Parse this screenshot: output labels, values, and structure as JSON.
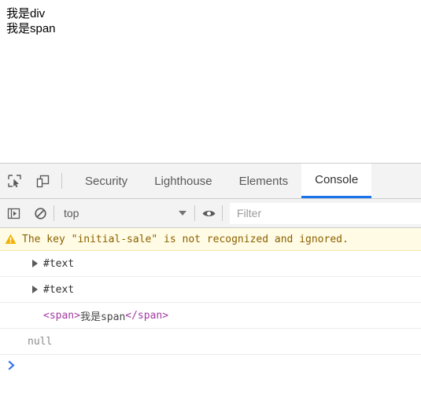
{
  "page": {
    "lines": [
      "我是div",
      "我是span"
    ]
  },
  "devtools": {
    "toolbar_icons": [
      {
        "name": "inspect-element-icon",
        "title": "Inspect element"
      },
      {
        "name": "device-toolbar-icon",
        "title": "Toggle device toolbar"
      }
    ],
    "tabs": [
      {
        "label": "Security",
        "active": false
      },
      {
        "label": "Lighthouse",
        "active": false
      },
      {
        "label": "Elements",
        "active": false
      },
      {
        "label": "Console",
        "active": true
      }
    ],
    "console_toolbar": {
      "sidebar_toggle_icon": "console-sidebar-icon",
      "clear_console_icon": "clear-console-icon",
      "context": "top",
      "context_caret_icon": "chevron-down-icon",
      "eye_icon": "live-expression-eye-icon",
      "filter_placeholder": "Filter"
    },
    "messages": [
      {
        "type": "warning",
        "icon": "warning-triangle-icon",
        "text": "The key \"initial-sale\" is not recognized and ignored."
      },
      {
        "type": "node",
        "text": "#text",
        "expandable": true
      },
      {
        "type": "node",
        "text": "#text",
        "expandable": true
      },
      {
        "type": "dom",
        "open_tag": "<span>",
        "inner": "我是span",
        "close_tag": "</span>"
      },
      {
        "type": "value",
        "text": "null"
      }
    ],
    "prompt": {
      "icon": "prompt-chevron-icon",
      "value": ""
    }
  },
  "colors": {
    "accent": "#1a73e8",
    "warning_bg": "#fffbe5",
    "warning_fg": "#8a6100",
    "warning_icon": "#f2b203",
    "tag": "#a33aa3",
    "prompt": "#3b78e7"
  }
}
